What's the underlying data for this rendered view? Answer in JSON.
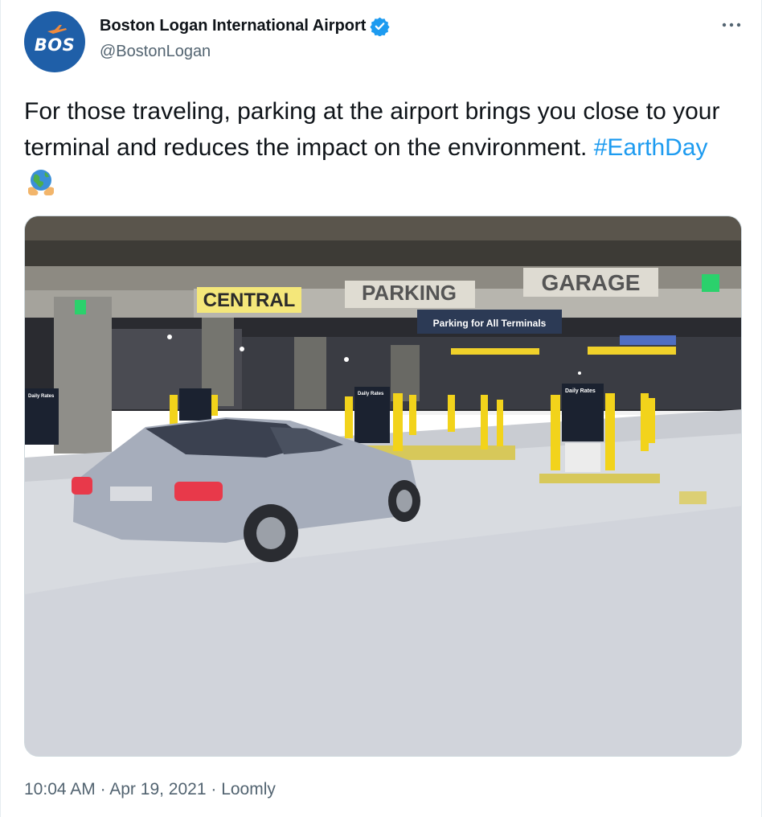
{
  "tweet": {
    "author": {
      "display_name": "Boston Logan International Airport",
      "handle": "@BostonLogan",
      "avatar_text": "BOS",
      "verified": true,
      "avatar_color": "#1f5fa8"
    },
    "text_main": "For those traveling, parking at the airport brings you close to your terminal and reduces the impact on the environment. ",
    "hashtag": "#EarthDay",
    "emoji_icon": "earth-globe-hands-icon",
    "media": {
      "signs": {
        "central": "CENTRAL",
        "parking": "PARKING",
        "garage": "GARAGE",
        "overhead": "Parking for All Terminals",
        "rates_left": "Daily Rates",
        "rates_center": "Daily Rates",
        "rates_right": "Daily Rates"
      }
    },
    "meta": {
      "time": "10:04 AM",
      "separator": " · ",
      "date": "Apr 19, 2021",
      "source": "Loomly"
    }
  },
  "colors": {
    "link": "#1d9bf0",
    "muted": "#536471",
    "text": "#0f1419"
  }
}
